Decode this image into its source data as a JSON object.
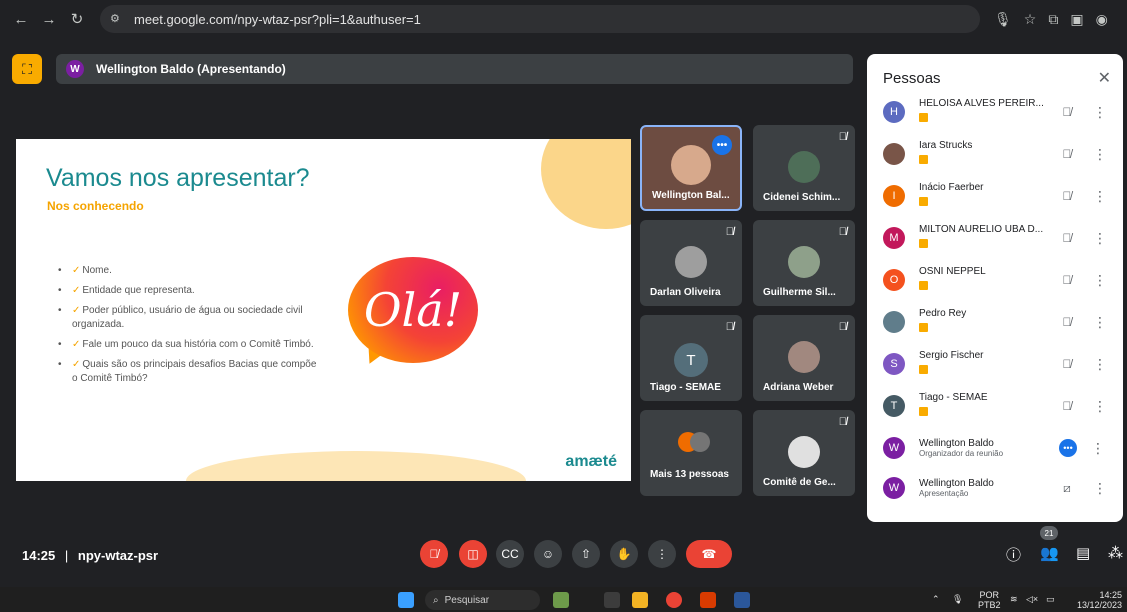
{
  "browser": {
    "url": "meet.google.com/npy-wtaz-psr?pli=1&authuser=1",
    "icons": [
      "back-icon",
      "forward-icon",
      "reload-icon",
      "site-settings-icon",
      "mic-icon",
      "star-icon",
      "extensions-icon",
      "sidebar-icon",
      "profile-icon"
    ]
  },
  "meet": {
    "presenter_avatar": "W",
    "presenter_label": "Wellington Baldo (Apresentando)"
  },
  "slide": {
    "title": "Vamos nos apresentar?",
    "subtitle": "Nos conhecendo",
    "bullets": [
      "Nome.",
      "Entidade que representa.",
      "Poder público, usuário de água ou sociedade civil organizada.",
      "Fale um pouco da sua história com o Comitê Timbó.",
      "Quais são os principais desafios Bacias que compõe o Comitê Timbó?"
    ],
    "bubble_text": "Olá!",
    "logo": "amæté"
  },
  "tiles": [
    {
      "name": "Wellington Bal...",
      "type": "video"
    },
    {
      "name": "Cidenei Schim...",
      "type": "photo"
    },
    {
      "name": "Darlan Oliveira",
      "type": "photo"
    },
    {
      "name": "Guilherme Sil...",
      "type": "photo"
    },
    {
      "name": "Tiago - SEMAE",
      "type": "letter",
      "letter": "T"
    },
    {
      "name": "Adriana Weber",
      "type": "photo"
    },
    {
      "name": "Mais 13 pessoas",
      "type": "more"
    },
    {
      "name": "Comitê de Ge...",
      "type": "photo"
    }
  ],
  "people_panel": {
    "title": "Pessoas",
    "people": [
      {
        "name": "HELOISA ALVES PEREIR...",
        "avatar": "H",
        "color": "#5c6bc0"
      },
      {
        "name": "Iara Strucks",
        "avatar": "",
        "color": "#795548"
      },
      {
        "name": "Inácio Faerber",
        "avatar": "I",
        "color": "#ef6c00"
      },
      {
        "name": "MILTON AURELIO UBA D...",
        "avatar": "M",
        "color": "#c2185b"
      },
      {
        "name": "OSNI NEPPEL",
        "avatar": "O",
        "color": "#f4511e"
      },
      {
        "name": "Pedro Rey",
        "avatar": "",
        "color": "#607d8b"
      },
      {
        "name": "Sergio Fischer",
        "avatar": "S",
        "color": "#7e57c2"
      },
      {
        "name": "Tiago - SEMAE",
        "avatar": "T",
        "color": "#455a64"
      },
      {
        "name": "Wellington Baldo",
        "sub": "Organizador da reunião",
        "avatar": "W",
        "color": "#7b1fa2"
      },
      {
        "name": "Wellington Baldo",
        "sub": "Apresentação",
        "avatar": "W",
        "color": "#7b1fa2"
      }
    ]
  },
  "bottom": {
    "time": "14:25",
    "separator": "|",
    "meeting_code": "npy-wtaz-psr",
    "people_count": "21"
  },
  "taskbar": {
    "search_placeholder": "Pesquisar",
    "lang": "POR",
    "lang_sub": "PTB2",
    "clock_time": "14:25",
    "clock_date": "13/12/2023"
  }
}
